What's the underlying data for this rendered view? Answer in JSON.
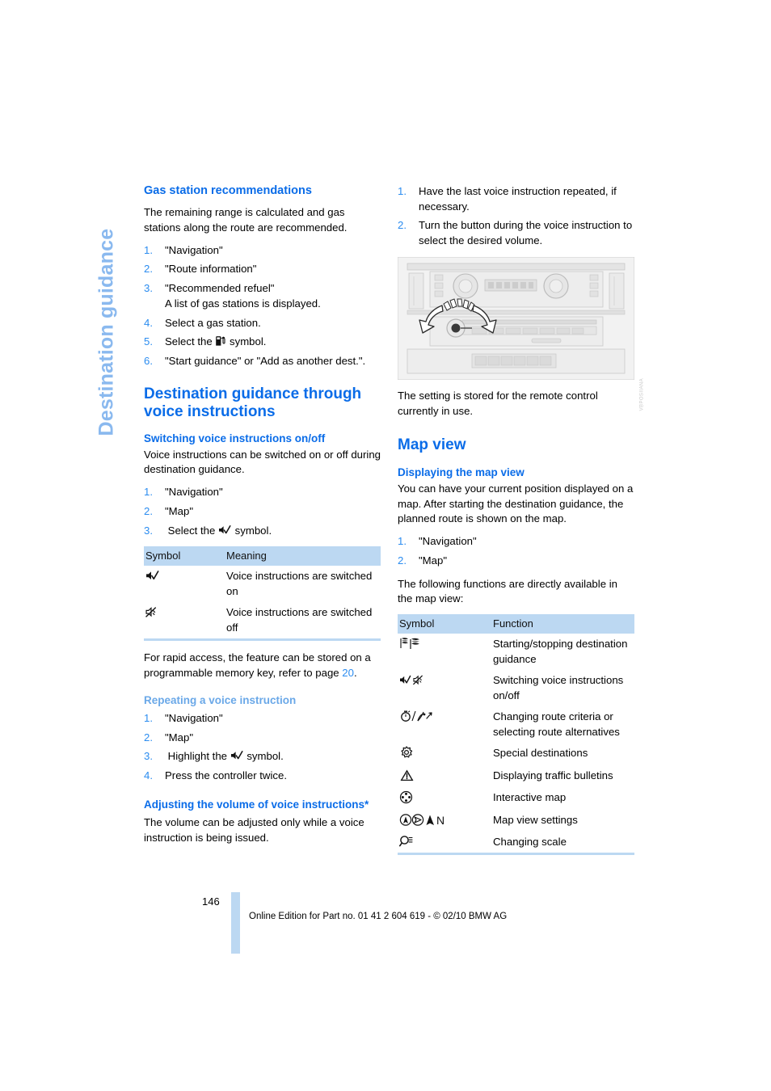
{
  "chapter_tab": "Destination guidance",
  "left_column": {
    "gas_section": {
      "heading": "Gas station recommendations",
      "intro": "The remaining range is calculated and gas stations along the route are recommended.",
      "steps": [
        {
          "num": "1.",
          "text": "\"Navigation\""
        },
        {
          "num": "2.",
          "text": "\"Route information\""
        },
        {
          "num": "3.",
          "text": "\"Recommended refuel\"",
          "sub": "A list of gas stations is displayed."
        },
        {
          "num": "4.",
          "text": "Select a gas station."
        },
        {
          "num": "5.",
          "text": "Select the",
          "icon": "gas-pump-icon",
          "text_after": "symbol."
        },
        {
          "num": "6.",
          "text": "\"Start guidance\" or \"Add as another dest.\"."
        }
      ]
    },
    "voice_section": {
      "heading": "Destination guidance through voice instructions",
      "sub_heading": "Switching voice instructions on/off",
      "intro": "Voice instructions can be switched on or off during destination guidance.",
      "steps": [
        {
          "num": "1.",
          "text": "\"Navigation\""
        },
        {
          "num": "2.",
          "text": "\"Map\""
        },
        {
          "num": "3.",
          "text": "Select the",
          "icon": "speaker-on-icon",
          "text_after": "symbol."
        }
      ]
    },
    "symbol_table": {
      "headers": [
        "Symbol",
        "Meaning"
      ],
      "rows": [
        {
          "icon": "speaker-on-icon",
          "meaning": "Voice instructions are switched on"
        },
        {
          "icon": "speaker-off-icon",
          "meaning": "Voice instructions are switched off"
        }
      ]
    },
    "memory_key_note_before": "For rapid access, the feature can be stored on a programmable memory key, refer to page ",
    "memory_key_page": "20",
    "memory_key_note_after": ".",
    "repeating_section": {
      "heading": "Repeating a voice instruction",
      "steps": [
        {
          "num": "1.",
          "text": "\"Navigation\""
        },
        {
          "num": "2.",
          "text": "\"Map\""
        },
        {
          "num": "3.",
          "text": "Highlight the",
          "icon": "speaker-on-icon",
          "text_after": "symbol."
        },
        {
          "num": "4.",
          "text": "Press the controller twice."
        }
      ]
    },
    "volume_section": {
      "heading": "Adjusting the volume of voice instructions*",
      "intro": "The volume can be adjusted only while a voice instruction is being issued."
    }
  },
  "right_column": {
    "volume_steps": [
      {
        "num": "1.",
        "text": "Have the last voice instruction repeated, if necessary."
      },
      {
        "num": "2.",
        "text": "Turn the button during the voice instruction to select the desired volume."
      }
    ],
    "figure": {
      "name": "center-console-volume-knob-illustration",
      "figure_id": "VBPOSIIANA"
    },
    "figure_note": "The setting is stored for the remote control currently in use.",
    "map_view": {
      "heading": "Map view",
      "sub_heading": "Displaying the map view",
      "intro": "You can have your current position displayed on a map. After starting the destination guidance, the planned route is shown on the map.",
      "steps": [
        {
          "num": "1.",
          "text": "\"Navigation\""
        },
        {
          "num": "2.",
          "text": "\"Map\""
        }
      ],
      "outro": "The following functions are directly available in the map view:"
    },
    "function_table": {
      "headers": [
        "Symbol",
        "Function"
      ],
      "rows": [
        {
          "icon": "checkered-flags-icon",
          "function": "Starting/stopping destination guidance"
        },
        {
          "icon": "speaker-on-off-icon",
          "function": "Switching voice instructions on/off"
        },
        {
          "icon": "route-criteria-icon",
          "function": "Changing route criteria or selecting route alternatives"
        },
        {
          "icon": "special-destinations-icon",
          "function": "Special destinations"
        },
        {
          "icon": "traffic-warning-icon",
          "function": "Displaying traffic bulletins"
        },
        {
          "icon": "interactive-map-icon",
          "function": "Interactive map"
        },
        {
          "icon": "map-view-settings-icon",
          "function": "Map view settings"
        },
        {
          "icon": "magnifier-scale-icon",
          "function": "Changing scale"
        }
      ]
    }
  },
  "footer": {
    "page_number": "146",
    "text": "Online Edition for Part no. 01 41 2 604 619 - © 02/10 BMW AG"
  },
  "colors": {
    "heading_blue": "#0a6ce8",
    "light_blue": "#8ab9ef",
    "number_blue": "#2b8cf0",
    "table_header_bg": "#bcd8f2"
  }
}
